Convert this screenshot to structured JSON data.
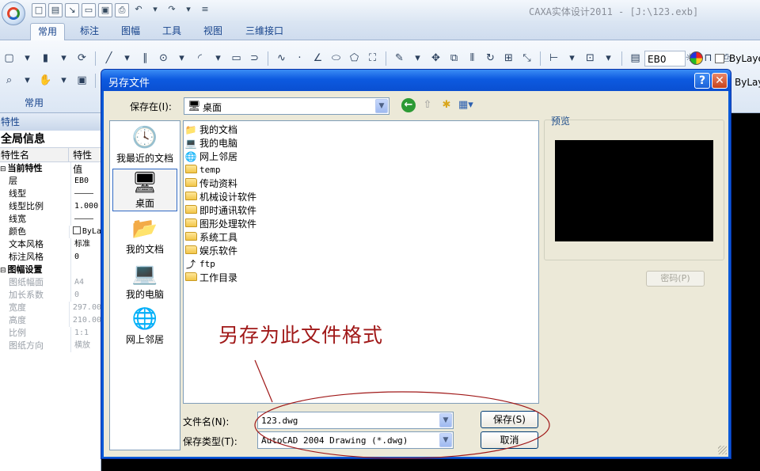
{
  "window": {
    "title": "CAXA实体设计2011 - [J:\\123.exb]"
  },
  "quick_access": {
    "icons": [
      "new-icon",
      "open-icon",
      "import-icon",
      "folder-icon",
      "save-icon",
      "print-icon",
      "undo-icon",
      "redo-icon",
      "customize-icon"
    ]
  },
  "ribbon": {
    "tabs": [
      "常用",
      "标注",
      "图幅",
      "工具",
      "视图",
      "三维接口"
    ],
    "active_tab": "常用",
    "group_label": "常用",
    "layer": "EB0",
    "linetype_1": "ByLaye",
    "linetype_2": "ByLaye",
    "text_tool": "A"
  },
  "properties": {
    "header": "特性",
    "global_info": "全局信息",
    "col_name": "特性名",
    "col_value": "特性值",
    "rows": [
      {
        "type": "section",
        "k": "当前特性",
        "v": ""
      },
      {
        "type": "row",
        "k": "层",
        "v": "EB0"
      },
      {
        "type": "row",
        "k": "线型",
        "v": "————"
      },
      {
        "type": "row",
        "k": "线型比例",
        "v": "1.000"
      },
      {
        "type": "row",
        "k": "线宽",
        "v": "————"
      },
      {
        "type": "row",
        "k": "颜色",
        "v": "ByLa"
      },
      {
        "type": "row",
        "k": "文本风格",
        "v": "标准"
      },
      {
        "type": "row",
        "k": "标注风格",
        "v": "0"
      },
      {
        "type": "section",
        "k": "图幅设置",
        "v": ""
      },
      {
        "type": "dim",
        "k": "图纸幅面",
        "v": "A4"
      },
      {
        "type": "dim",
        "k": "加长系数",
        "v": "0"
      },
      {
        "type": "dim",
        "k": "宽度",
        "v": "297.00"
      },
      {
        "type": "dim",
        "k": "高度",
        "v": "210.00"
      },
      {
        "type": "dim",
        "k": "比例",
        "v": "1:1"
      },
      {
        "type": "dim",
        "k": "图纸方向",
        "v": "横放"
      }
    ]
  },
  "dialog": {
    "title": "另存文件",
    "help_label": "?",
    "close_label": "✕",
    "save_in_label": "保存在(I):",
    "save_in_value": "桌面",
    "places": [
      {
        "label": "我最近的文档",
        "icon": "recent-documents-icon"
      },
      {
        "label": "桌面",
        "icon": "desktop-icon"
      },
      {
        "label": "我的文档",
        "icon": "my-documents-icon"
      },
      {
        "label": "我的电脑",
        "icon": "my-computer-icon"
      },
      {
        "label": "网上邻居",
        "icon": "network-places-icon"
      }
    ],
    "files": [
      {
        "name": "我的文档",
        "icon": "my-documents-icon"
      },
      {
        "name": "我的电脑",
        "icon": "my-computer-icon"
      },
      {
        "name": "网上邻居",
        "icon": "network-places-icon"
      },
      {
        "name": "temp",
        "icon": "folder-icon"
      },
      {
        "name": "传动资料",
        "icon": "folder-icon"
      },
      {
        "name": "机械设计软件",
        "icon": "folder-icon"
      },
      {
        "name": "即时通讯软件",
        "icon": "folder-icon"
      },
      {
        "name": "图形处理软件",
        "icon": "folder-icon"
      },
      {
        "name": "系统工具",
        "icon": "folder-icon"
      },
      {
        "name": "娱乐软件",
        "icon": "folder-icon"
      },
      {
        "name": "ftp",
        "icon": "shortcut-icon"
      },
      {
        "name": "工作目录",
        "icon": "shortcut-folder-icon"
      }
    ],
    "filename_label": "文件名(N):",
    "filename_value": "123.dwg",
    "filetype_label": "保存类型(T):",
    "filetype_value": "AutoCAD 2004 Drawing (*.dwg)",
    "save_button": "保存(S)",
    "cancel_button": "取消",
    "preview_label": "预览",
    "password_button": "密码(P)"
  },
  "annotation": {
    "text": "另存为此文件格式",
    "color": "#a01818"
  }
}
